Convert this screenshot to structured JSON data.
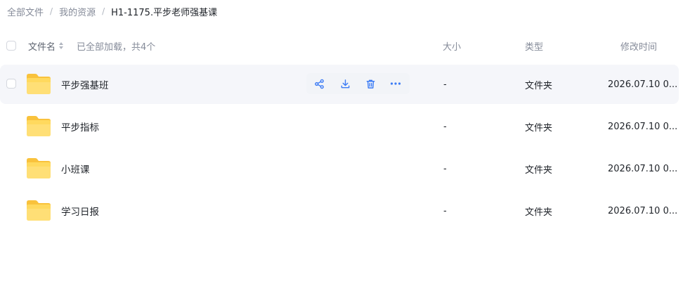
{
  "breadcrumb": {
    "items": [
      "全部文件",
      "我的资源"
    ],
    "separator": "/",
    "current": "H1-1175.平步老师强基课"
  },
  "header": {
    "name_label": "文件名",
    "loaded_text": "已全部加载，共4个",
    "size_label": "大小",
    "type_label": "类型",
    "mtime_label": "修改时间"
  },
  "files": [
    {
      "name": "平步强基班",
      "size": "-",
      "type": "文件夹",
      "mtime": "2026.07.10 0...",
      "hovered": true
    },
    {
      "name": "平步指标",
      "size": "-",
      "type": "文件夹",
      "mtime": "2026.07.10 0...",
      "hovered": false
    },
    {
      "name": "小班课",
      "size": "-",
      "type": "文件夹",
      "mtime": "2026.07.10 0...",
      "hovered": false
    },
    {
      "name": "学习日报",
      "size": "-",
      "type": "文件夹",
      "mtime": "2026.07.10 0...",
      "hovered": false
    }
  ],
  "row_actions": [
    {
      "name": "share",
      "icon": "share-icon"
    },
    {
      "name": "download",
      "icon": "download-icon"
    },
    {
      "name": "delete",
      "icon": "trash-icon"
    },
    {
      "name": "more",
      "icon": "more-icon"
    }
  ],
  "colors": {
    "accent": "#3d7cf5",
    "folder_light": "#ffe28a",
    "folder_dark": "#f9c23c",
    "row_hover_bg": "#f5f6fa",
    "muted_text": "#858b99"
  }
}
